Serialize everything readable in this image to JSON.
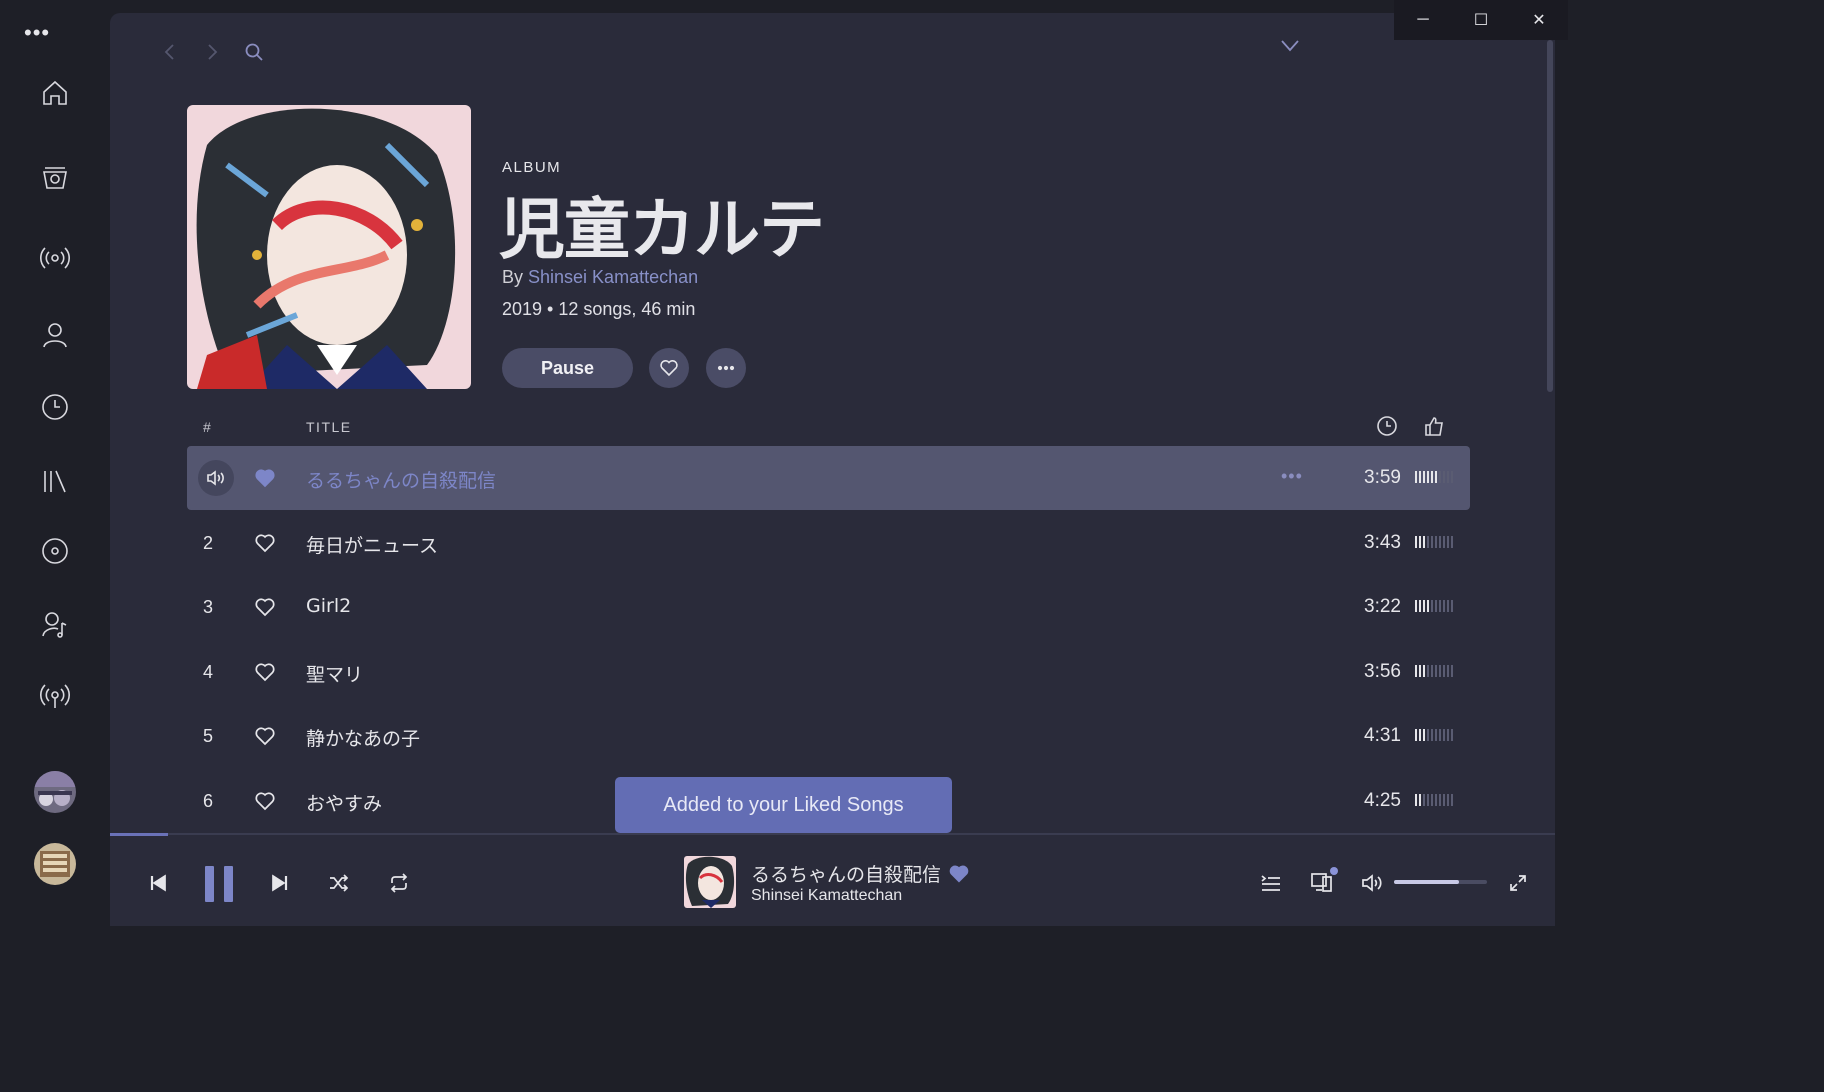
{
  "window": {
    "minimize": "─",
    "maximize": "☐",
    "close": "✕"
  },
  "rail": {
    "menu": "•••",
    "items": [
      {
        "name": "home-icon"
      },
      {
        "name": "store-icon"
      },
      {
        "name": "radio-icon"
      },
      {
        "name": "profile-icon"
      },
      {
        "name": "recent-icon"
      },
      {
        "name": "library-icon"
      },
      {
        "name": "albums-icon"
      },
      {
        "name": "artists-icon"
      },
      {
        "name": "podcasts-icon"
      }
    ]
  },
  "album": {
    "kind": "ALBUM",
    "title": "児童カルテ",
    "by_prefix": "By ",
    "artist": "Shinsei Kamattechan",
    "meta": "2019 • 12 songs, 46 min",
    "pause_label": "Pause"
  },
  "table": {
    "num_header": "#",
    "title_header": "TITLE",
    "rows": [
      {
        "num": "",
        "title": "るるちゃんの自殺配信",
        "duration": "3:59",
        "liked": true,
        "playing": true,
        "popularity": 0.6
      },
      {
        "num": "2",
        "title": "毎日がニュース",
        "duration": "3:43",
        "liked": false,
        "playing": false,
        "popularity": 0.3
      },
      {
        "num": "3",
        "title": "Girl2",
        "duration": "3:22",
        "liked": false,
        "playing": false,
        "popularity": 0.4
      },
      {
        "num": "4",
        "title": "聖マリ",
        "duration": "3:56",
        "liked": false,
        "playing": false,
        "popularity": 0.3
      },
      {
        "num": "5",
        "title": "静かなあの子",
        "duration": "4:31",
        "liked": false,
        "playing": false,
        "popularity": 0.3
      },
      {
        "num": "6",
        "title": "おやすみ",
        "duration": "4:25",
        "liked": false,
        "playing": false,
        "popularity": 0.2
      }
    ]
  },
  "toast": {
    "text": "Added to your Liked Songs"
  },
  "now_playing": {
    "title": "るるちゃんの自殺配信",
    "artist": "Shinsei Kamattechan",
    "progress": 0.04,
    "volume": 0.7
  },
  "colors": {
    "accent": "#7d86c8",
    "panel": "#2a2b3a",
    "rail": "#1e1f27",
    "toast": "#636db4"
  }
}
